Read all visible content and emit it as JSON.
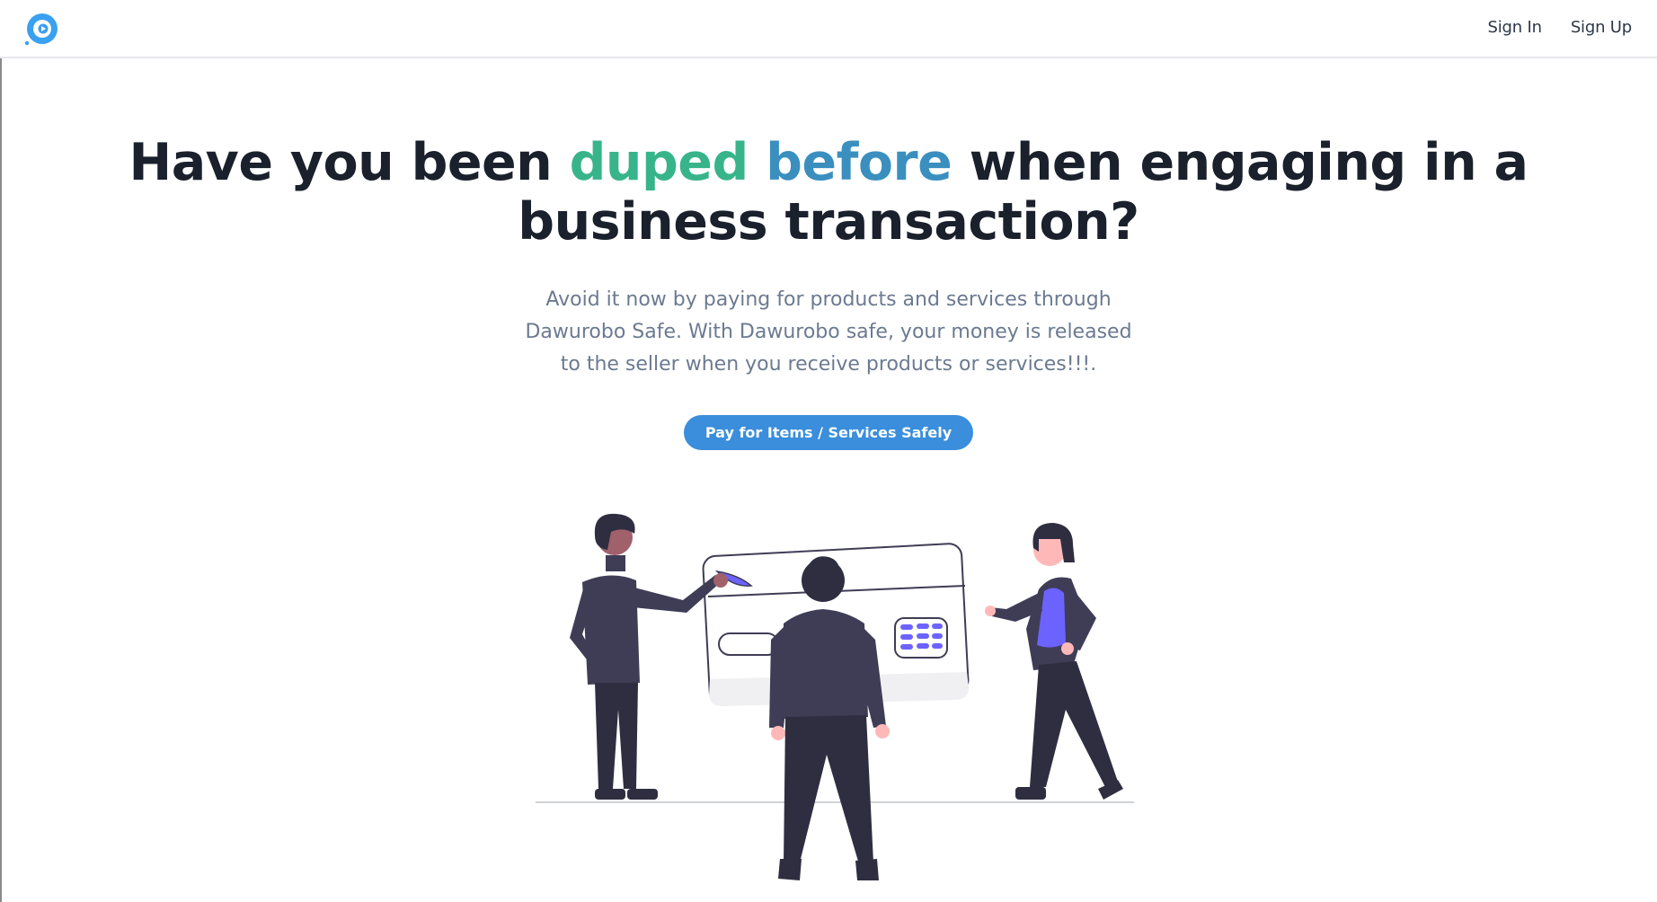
{
  "header": {
    "sign_in": "Sign In",
    "sign_up": "Sign Up",
    "logo_icon": "app-logo-icon"
  },
  "hero": {
    "headline_part1": "Have you been ",
    "headline_green": "duped",
    "headline_space": " ",
    "headline_blue": "before",
    "headline_part2": " when engaging in a business transaction?",
    "subtitle": "Avoid it now by paying for products and services through Dawurobo Safe. With Dawurobo safe, your money is released to the seller when you receive products or services!!!.",
    "cta_label": "Pay for Items / Services Safely"
  },
  "colors": {
    "accent_green": "#38b48b",
    "accent_blue": "#3a8fbf",
    "button_blue": "#3a8edb",
    "illustration_purple": "#6c63ff",
    "figure_dark": "#3f3d56"
  }
}
